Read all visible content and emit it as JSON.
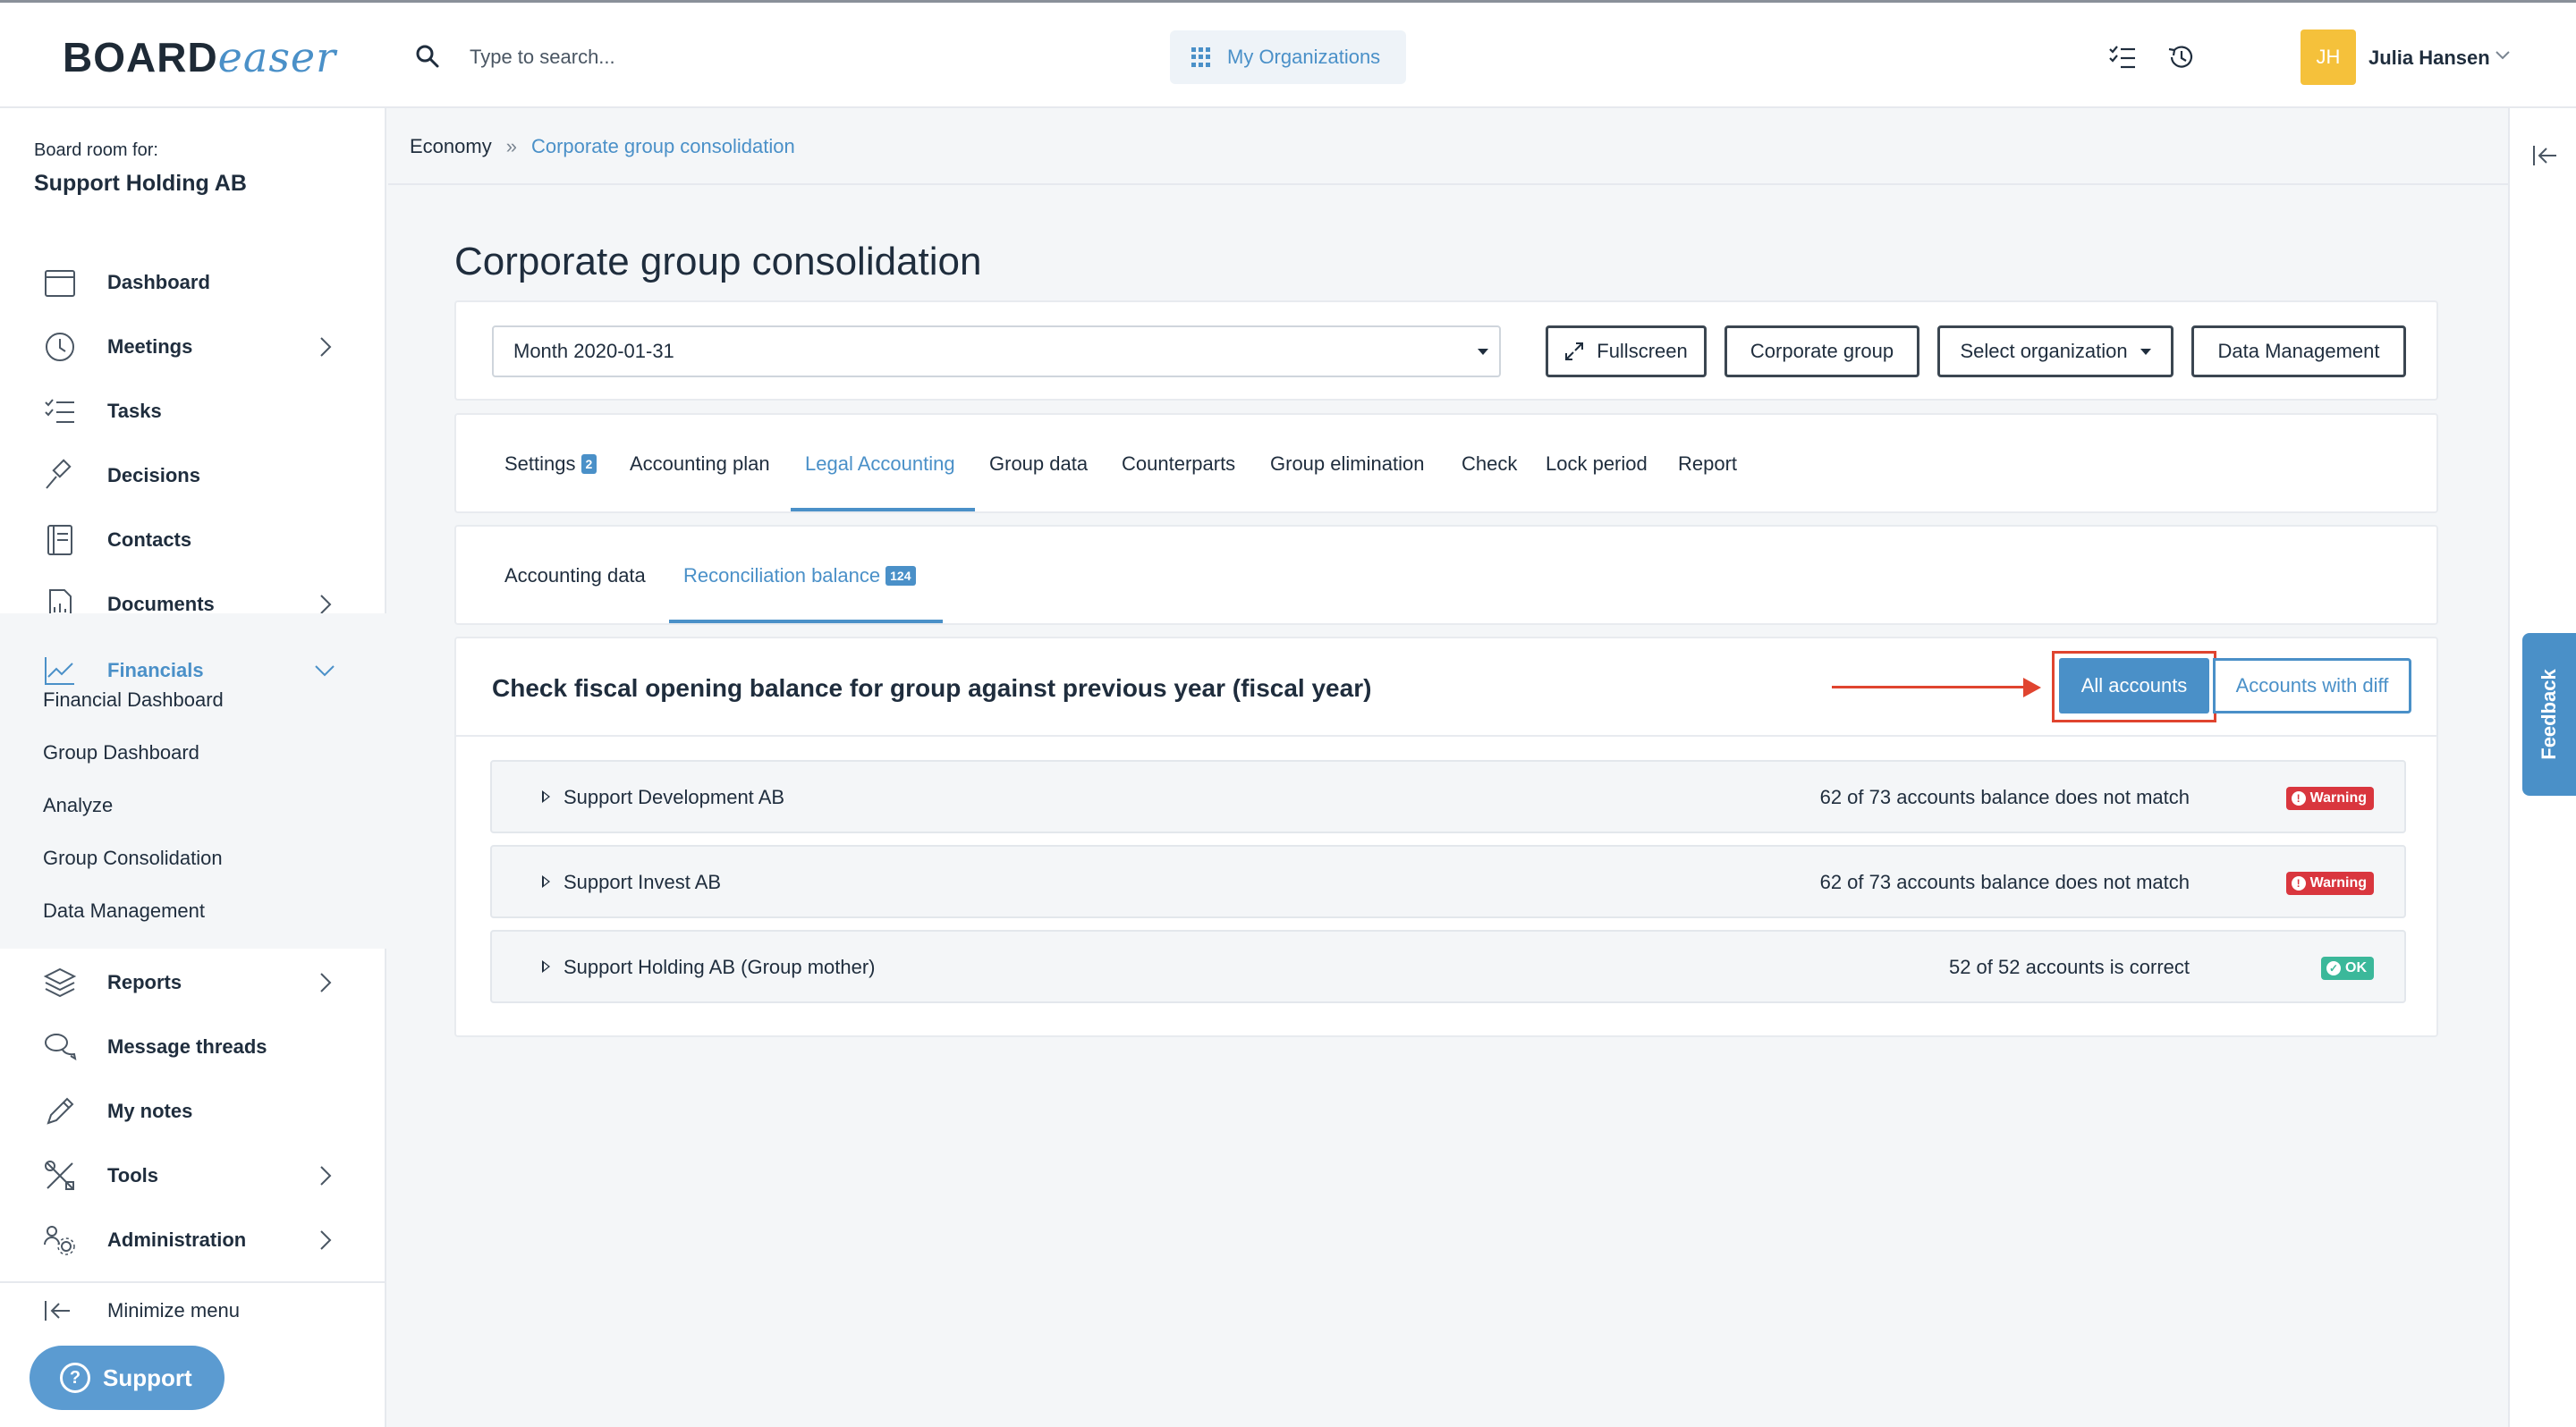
{
  "app": {
    "logo_primary": "BOARD",
    "logo_secondary": "easer"
  },
  "header": {
    "search_placeholder": "Type to search...",
    "organizations_label": "My Organizations",
    "user_initials": "JH",
    "user_name": "Julia Hansen"
  },
  "sidebar": {
    "board_room_label": "Board room for:",
    "organization": "Support Holding AB",
    "items": [
      {
        "label": "Dashboard",
        "icon": "calendar-icon"
      },
      {
        "label": "Meetings",
        "icon": "clock-icon"
      },
      {
        "label": "Tasks",
        "icon": "checklist-icon"
      },
      {
        "label": "Decisions",
        "icon": "gavel-icon"
      },
      {
        "label": "Contacts",
        "icon": "contacts-book-icon"
      },
      {
        "label": "Documents",
        "icon": "document-icon"
      },
      {
        "label": "Financials",
        "icon": "line-chart-icon"
      },
      {
        "label": "Reports",
        "icon": "layers-icon"
      },
      {
        "label": "Message threads",
        "icon": "chat-bubbles-icon"
      },
      {
        "label": "My notes",
        "icon": "pencil-icon"
      },
      {
        "label": "Tools",
        "icon": "tools-icon"
      },
      {
        "label": "Administration",
        "icon": "users-gear-icon"
      }
    ],
    "financials_sub": [
      "Financial Dashboard",
      "Group Dashboard",
      "Analyze",
      "Group Consolidation",
      "Data Management"
    ],
    "minimize_label": "Minimize menu",
    "support_label": "Support"
  },
  "breadcrumb": {
    "parent": "Economy",
    "current": "Corporate group consolidation"
  },
  "page": {
    "title": "Corporate group consolidation",
    "period_select": "Month 2020-01-31",
    "buttons": {
      "fullscreen": "Fullscreen",
      "corporate_group": "Corporate group",
      "select_org": "Select organization",
      "data_management": "Data Management"
    },
    "tabs": [
      {
        "label": "Settings",
        "badge": "2"
      },
      {
        "label": "Accounting plan"
      },
      {
        "label": "Legal Accounting"
      },
      {
        "label": "Group data"
      },
      {
        "label": "Counterparts"
      },
      {
        "label": "Group elimination"
      },
      {
        "label": "Check"
      },
      {
        "label": "Lock period"
      },
      {
        "label": "Report"
      }
    ],
    "active_tab": "Legal Accounting",
    "subtabs": [
      {
        "label": "Accounting data"
      },
      {
        "label": "Reconciliation balance",
        "badge": "124"
      }
    ],
    "active_subtab": "Reconciliation balance",
    "section_title": "Check fiscal opening balance for group against previous year (fiscal year)",
    "filter_all": "All accounts",
    "filter_diff": "Accounts with diff",
    "rows": [
      {
        "name": "Support Development AB",
        "status": "62 of 73 accounts balance does not match",
        "badge": "Warning",
        "badge_type": "warning"
      },
      {
        "name": "Support Invest AB",
        "status": "62 of 73 accounts balance does not match",
        "badge": "Warning",
        "badge_type": "warning"
      },
      {
        "name": "Support Holding AB (Group mother)",
        "status": "52 of 52 accounts is correct",
        "badge": "OK",
        "badge_type": "ok"
      }
    ]
  },
  "feedback_label": "Feedback",
  "colors": {
    "accent": "#4a90c8",
    "warning": "#d9363e",
    "ok": "#3bb89a",
    "annotation": "#e0442f",
    "avatar": "#f5c13b"
  }
}
